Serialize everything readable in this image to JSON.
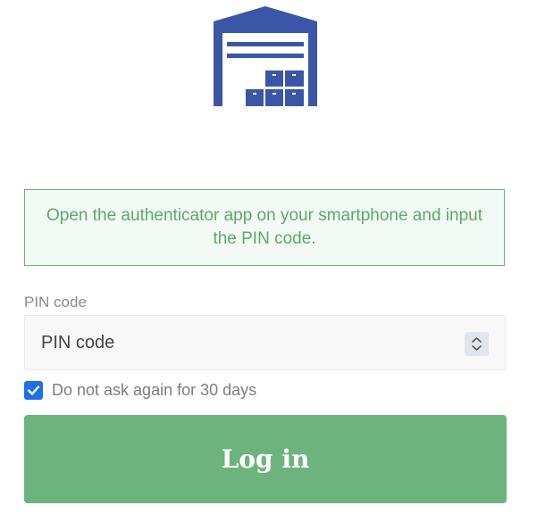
{
  "colors": {
    "brand": "#3b56a8",
    "accent_green": "#6db37e",
    "checkbox_blue": "#1f6fe5"
  },
  "logo": {
    "icon": "warehouse-icon"
  },
  "notice": {
    "text": "Open the authenticator app on your smartphone and input the PIN code."
  },
  "pin": {
    "label": "PIN code",
    "placeholder": "PIN code",
    "value": ""
  },
  "remember": {
    "checked": true,
    "label": "Do not ask again for 30 days"
  },
  "login_button": {
    "label": "Log in"
  }
}
